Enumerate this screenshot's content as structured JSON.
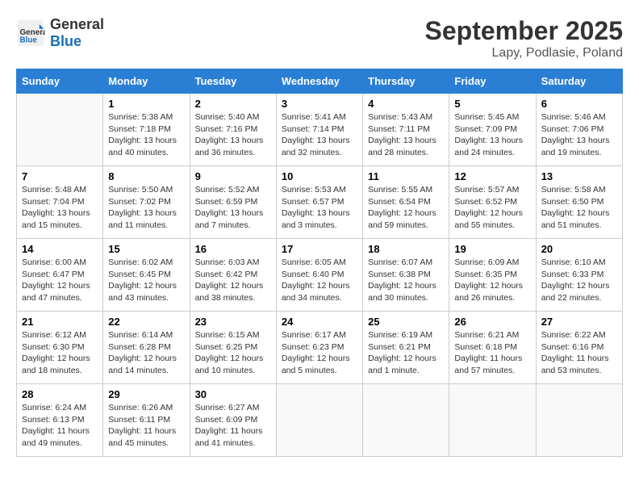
{
  "header": {
    "logo_line1": "General",
    "logo_line2": "Blue",
    "title": "September 2025",
    "subtitle": "Lapy, Podlasie, Poland"
  },
  "weekdays": [
    "Sunday",
    "Monday",
    "Tuesday",
    "Wednesday",
    "Thursday",
    "Friday",
    "Saturday"
  ],
  "weeks": [
    [
      {
        "day": "",
        "info": ""
      },
      {
        "day": "1",
        "info": "Sunrise: 5:38 AM\nSunset: 7:18 PM\nDaylight: 13 hours\nand 40 minutes."
      },
      {
        "day": "2",
        "info": "Sunrise: 5:40 AM\nSunset: 7:16 PM\nDaylight: 13 hours\nand 36 minutes."
      },
      {
        "day": "3",
        "info": "Sunrise: 5:41 AM\nSunset: 7:14 PM\nDaylight: 13 hours\nand 32 minutes."
      },
      {
        "day": "4",
        "info": "Sunrise: 5:43 AM\nSunset: 7:11 PM\nDaylight: 13 hours\nand 28 minutes."
      },
      {
        "day": "5",
        "info": "Sunrise: 5:45 AM\nSunset: 7:09 PM\nDaylight: 13 hours\nand 24 minutes."
      },
      {
        "day": "6",
        "info": "Sunrise: 5:46 AM\nSunset: 7:06 PM\nDaylight: 13 hours\nand 19 minutes."
      }
    ],
    [
      {
        "day": "7",
        "info": "Sunrise: 5:48 AM\nSunset: 7:04 PM\nDaylight: 13 hours\nand 15 minutes."
      },
      {
        "day": "8",
        "info": "Sunrise: 5:50 AM\nSunset: 7:02 PM\nDaylight: 13 hours\nand 11 minutes."
      },
      {
        "day": "9",
        "info": "Sunrise: 5:52 AM\nSunset: 6:59 PM\nDaylight: 13 hours\nand 7 minutes."
      },
      {
        "day": "10",
        "info": "Sunrise: 5:53 AM\nSunset: 6:57 PM\nDaylight: 13 hours\nand 3 minutes."
      },
      {
        "day": "11",
        "info": "Sunrise: 5:55 AM\nSunset: 6:54 PM\nDaylight: 12 hours\nand 59 minutes."
      },
      {
        "day": "12",
        "info": "Sunrise: 5:57 AM\nSunset: 6:52 PM\nDaylight: 12 hours\nand 55 minutes."
      },
      {
        "day": "13",
        "info": "Sunrise: 5:58 AM\nSunset: 6:50 PM\nDaylight: 12 hours\nand 51 minutes."
      }
    ],
    [
      {
        "day": "14",
        "info": "Sunrise: 6:00 AM\nSunset: 6:47 PM\nDaylight: 12 hours\nand 47 minutes."
      },
      {
        "day": "15",
        "info": "Sunrise: 6:02 AM\nSunset: 6:45 PM\nDaylight: 12 hours\nand 43 minutes."
      },
      {
        "day": "16",
        "info": "Sunrise: 6:03 AM\nSunset: 6:42 PM\nDaylight: 12 hours\nand 38 minutes."
      },
      {
        "day": "17",
        "info": "Sunrise: 6:05 AM\nSunset: 6:40 PM\nDaylight: 12 hours\nand 34 minutes."
      },
      {
        "day": "18",
        "info": "Sunrise: 6:07 AM\nSunset: 6:38 PM\nDaylight: 12 hours\nand 30 minutes."
      },
      {
        "day": "19",
        "info": "Sunrise: 6:09 AM\nSunset: 6:35 PM\nDaylight: 12 hours\nand 26 minutes."
      },
      {
        "day": "20",
        "info": "Sunrise: 6:10 AM\nSunset: 6:33 PM\nDaylight: 12 hours\nand 22 minutes."
      }
    ],
    [
      {
        "day": "21",
        "info": "Sunrise: 6:12 AM\nSunset: 6:30 PM\nDaylight: 12 hours\nand 18 minutes."
      },
      {
        "day": "22",
        "info": "Sunrise: 6:14 AM\nSunset: 6:28 PM\nDaylight: 12 hours\nand 14 minutes."
      },
      {
        "day": "23",
        "info": "Sunrise: 6:15 AM\nSunset: 6:25 PM\nDaylight: 12 hours\nand 10 minutes."
      },
      {
        "day": "24",
        "info": "Sunrise: 6:17 AM\nSunset: 6:23 PM\nDaylight: 12 hours\nand 5 minutes."
      },
      {
        "day": "25",
        "info": "Sunrise: 6:19 AM\nSunset: 6:21 PM\nDaylight: 12 hours\nand 1 minute."
      },
      {
        "day": "26",
        "info": "Sunrise: 6:21 AM\nSunset: 6:18 PM\nDaylight: 11 hours\nand 57 minutes."
      },
      {
        "day": "27",
        "info": "Sunrise: 6:22 AM\nSunset: 6:16 PM\nDaylight: 11 hours\nand 53 minutes."
      }
    ],
    [
      {
        "day": "28",
        "info": "Sunrise: 6:24 AM\nSunset: 6:13 PM\nDaylight: 11 hours\nand 49 minutes."
      },
      {
        "day": "29",
        "info": "Sunrise: 6:26 AM\nSunset: 6:11 PM\nDaylight: 11 hours\nand 45 minutes."
      },
      {
        "day": "30",
        "info": "Sunrise: 6:27 AM\nSunset: 6:09 PM\nDaylight: 11 hours\nand 41 minutes."
      },
      {
        "day": "",
        "info": ""
      },
      {
        "day": "",
        "info": ""
      },
      {
        "day": "",
        "info": ""
      },
      {
        "day": "",
        "info": ""
      }
    ]
  ]
}
